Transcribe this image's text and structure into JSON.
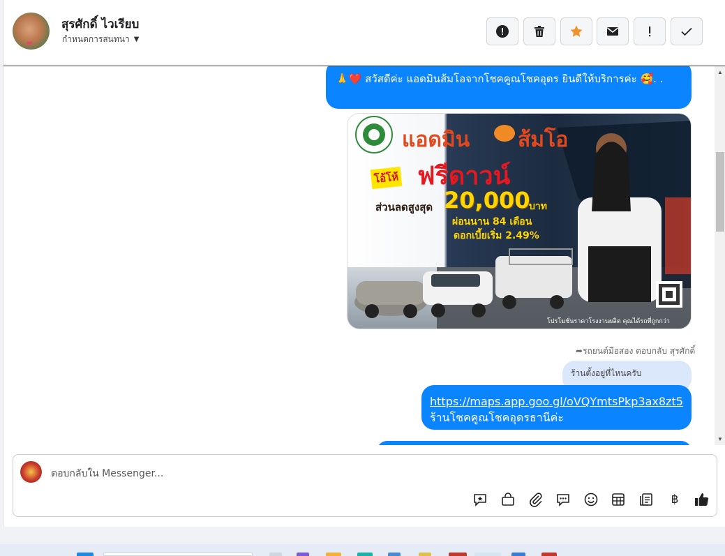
{
  "header": {
    "contact_name": "สุรศักดิ์ ไวเรียบ",
    "assign_label": "กำหนดการสนทนา",
    "buttons": [
      "alert-circle",
      "trash",
      "star",
      "mail",
      "exclamation",
      "check"
    ],
    "star_color": "#f0932b"
  },
  "messages": {
    "greeting": "🙏❤️ สวัสดีค่ะ แอดมินส้มโอจากโชคคูณโชคอุดร ยินดีให้บริการค่ะ 🥰. .",
    "promo_image": {
      "title_left": "แอดมิน",
      "title_right": "ส้มโอ",
      "badge": "โอ้โห้",
      "headline": "ฟรีดาวน์",
      "discount_label": "ส่วนลดสูงสุด",
      "discount_value": "20,000",
      "discount_unit": "บาท",
      "installment": "ผ่อนนาน 84 เดือน",
      "interest": "ดอกเบี้ยเริ่ม 2.49%",
      "footer": "โปรโมชั่นราคาโรงงานผลิต คุณได้รถที่ถูกกว่า"
    },
    "reply_hint": "รถยนต์มือสอง ตอบกลับ สุรศักดิ์",
    "customer_reply": "ร้านตั้งอยู่ที่ไหนครับ",
    "link": "https://maps.app.goo.gl/oVQYmtsPkp3ax8zt5",
    "shop_name": "ร้านโชคคูณโชคอุดรธานีค่ะ"
  },
  "composer": {
    "placeholder": "ตอบกลับใน Messenger...",
    "tools": [
      "quick-reply",
      "shopping-bag",
      "attachment",
      "chat-bubbles",
      "emoji",
      "table",
      "notes",
      "baht",
      "like"
    ],
    "baht_symbol": "฿"
  },
  "colors": {
    "bubble_blue": "#0b84ff",
    "bubble_grey": "#dbe7fb"
  }
}
